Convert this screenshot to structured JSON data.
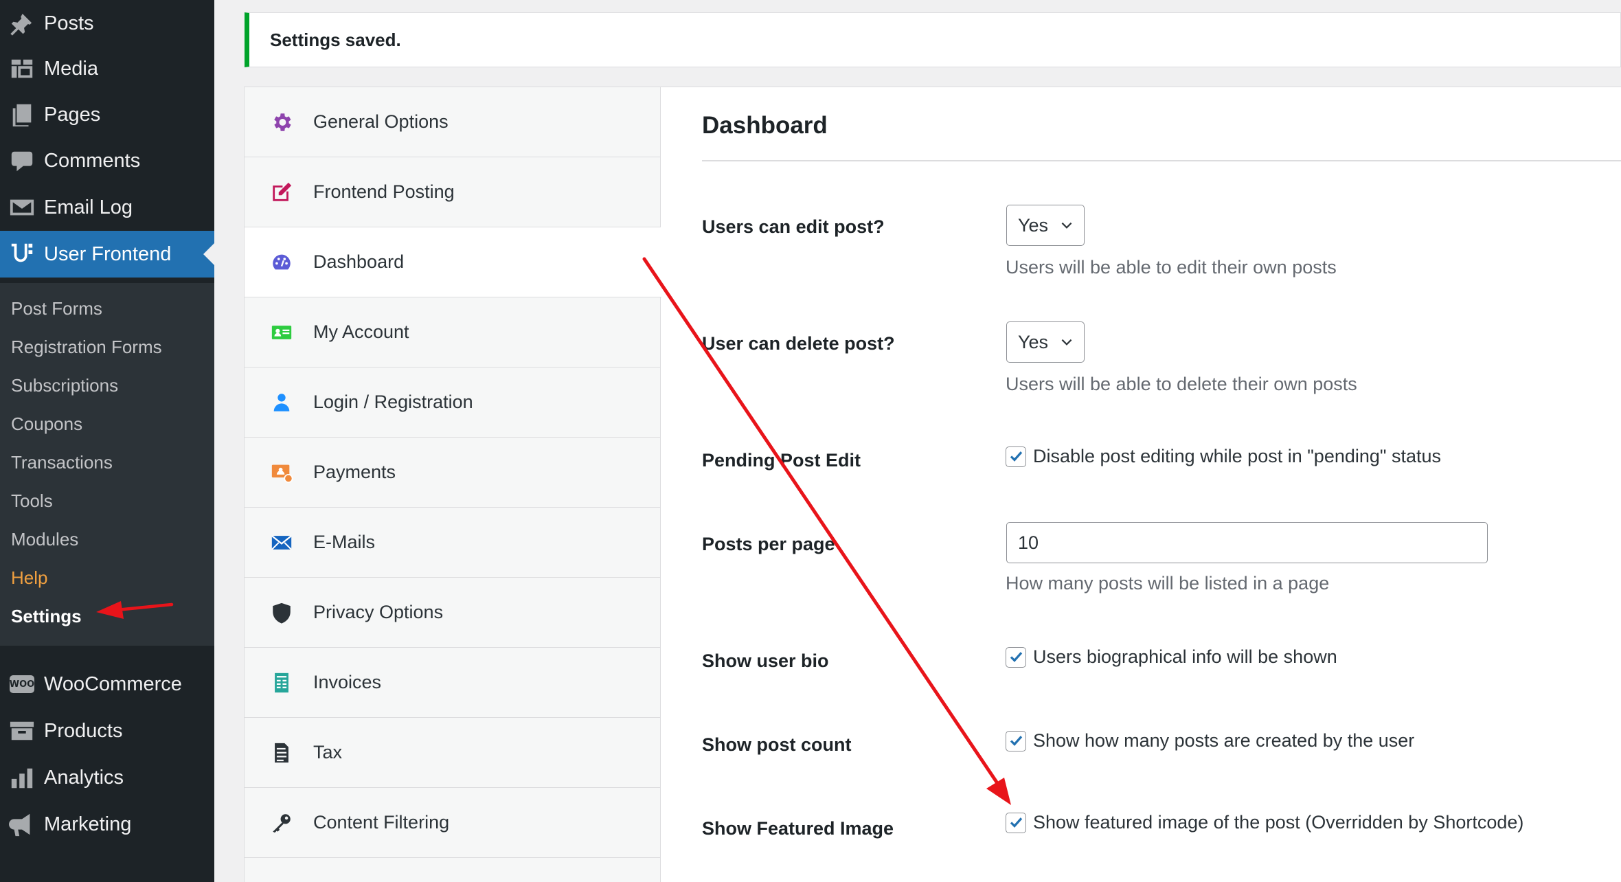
{
  "sidebar": {
    "top_items": [
      {
        "label": "Posts",
        "icon": "pin-icon"
      },
      {
        "label": "Media",
        "icon": "media-icon"
      },
      {
        "label": "Pages",
        "icon": "pages-icon"
      },
      {
        "label": "Comments",
        "icon": "comments-icon"
      },
      {
        "label": "Email Log",
        "icon": "email-icon"
      },
      {
        "label": "User Frontend",
        "icon": "user-frontend-icon"
      }
    ],
    "submenu": [
      {
        "label": "Post Forms"
      },
      {
        "label": "Registration Forms"
      },
      {
        "label": "Subscriptions"
      },
      {
        "label": "Coupons"
      },
      {
        "label": "Transactions"
      },
      {
        "label": "Tools"
      },
      {
        "label": "Modules"
      },
      {
        "label": "Help"
      },
      {
        "label": "Settings"
      }
    ],
    "bottom_items": [
      {
        "label": "WooCommerce",
        "badge": "WOO"
      },
      {
        "label": "Products",
        "icon": "archive-icon"
      },
      {
        "label": "Analytics",
        "icon": "chart-icon"
      },
      {
        "label": "Marketing",
        "icon": "megaphone-icon"
      }
    ],
    "colors": {
      "bg": "#1d2327",
      "sub_bg": "#2c3338",
      "active": "#2271b1",
      "help": "#f0a040"
    }
  },
  "notice": {
    "text": "Settings saved.",
    "color": "#00a32a"
  },
  "tabs": [
    {
      "label": "General Options",
      "icon": "gear-icon"
    },
    {
      "label": "Frontend Posting",
      "icon": "edit-icon"
    },
    {
      "label": "Dashboard",
      "icon": "dashboard-icon"
    },
    {
      "label": "My Account",
      "icon": "id-card-icon"
    },
    {
      "label": "Login / Registration",
      "icon": "user-icon"
    },
    {
      "label": "Payments",
      "icon": "payment-icon"
    },
    {
      "label": "E-Mails",
      "icon": "envelope-icon"
    },
    {
      "label": "Privacy Options",
      "icon": "shield-icon"
    },
    {
      "label": "Invoices",
      "icon": "invoice-icon"
    },
    {
      "label": "Tax",
      "icon": "document-icon"
    },
    {
      "label": "Content Filtering",
      "icon": "key-icon"
    }
  ],
  "panel": {
    "title": "Dashboard",
    "rows": {
      "edit_post": {
        "label": "Users can edit post?",
        "value": "Yes",
        "desc": "Users will be able to edit their own posts"
      },
      "delete_post": {
        "label": "User can delete post?",
        "value": "Yes",
        "desc": "Users will be able to delete their own posts"
      },
      "pending_edit": {
        "label": "Pending Post Edit",
        "checked": true,
        "text": "Disable post editing while post in \"pending\" status"
      },
      "posts_per_page": {
        "label": "Posts per page",
        "value": "10",
        "desc": "How many posts will be listed in a page"
      },
      "user_bio": {
        "label": "Show user bio",
        "checked": true,
        "text": "Users biographical info will be shown"
      },
      "post_count": {
        "label": "Show post count",
        "checked": true,
        "text": "Show how many posts are created by the user"
      },
      "featured_image": {
        "label": "Show Featured Image",
        "checked": true,
        "text": "Show featured image of the post (Overridden by Shortcode)"
      }
    }
  },
  "annotation_color": "#e8141a"
}
